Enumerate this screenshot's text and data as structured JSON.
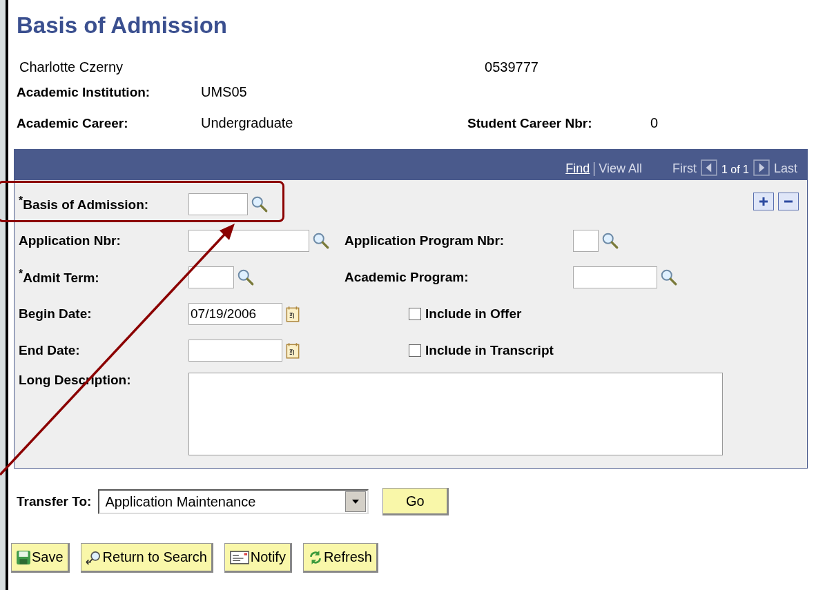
{
  "page_title": "Basis of Admission",
  "student": {
    "name": "Charlotte Czerny",
    "id": "0539777"
  },
  "info": [
    {
      "label": "Academic Institution:",
      "value": "UMS05"
    },
    {
      "label": "Academic Career:",
      "value": "Undergraduate",
      "extra_label": "Student Career Nbr:",
      "extra_value": "0"
    }
  ],
  "scroll_bar": {
    "find": "Find",
    "view_all": "View All",
    "first": "First",
    "counter": "1 of 1",
    "last": "Last"
  },
  "rows": [
    [
      {
        "kind": "lookup",
        "label": "$^{*}$Basis of Admission:"
      }
    ],
    [
      {
        "kind": "lookup",
        "label": "Application Nbr:"
      },
      {
        "kind": "lookup",
        "label": "Application Program Nbr:"
      }
    ],
    [
      {
        "kind": "lookup",
        "label": "$^{*}$Admit Term:"
      },
      {
        "kind": "lookup",
        "label": "Academic Program:"
      }
    ],
    [
      {
        "kind": "date",
        "label": "Begin Date:",
        "value": "07/19/2006"
      },
      {
        "kind": "checkbox",
        "label": "Include in Offer",
        "checked": false
      }
    ],
    [
      {
        "kind": "date",
        "label": "End Date:"
      },
      {
        "kind": "checkbox",
        "label": "Include in Transcript",
        "checked": false
      }
    ],
    [
      {
        "kind": "textarea",
        "label": "Long Description:"
      }
    ]
  ],
  "transfer": {
    "label": "Transfer To:",
    "value": "Application Maintenance",
    "go": "Go"
  },
  "buttons": [
    {
      "kind": "save",
      "label": "Save"
    },
    {
      "kind": "search",
      "label": "Return to Search"
    },
    {
      "kind": "notify",
      "label": "Notify"
    },
    {
      "kind": "refresh",
      "label": "Refresh"
    }
  ]
}
